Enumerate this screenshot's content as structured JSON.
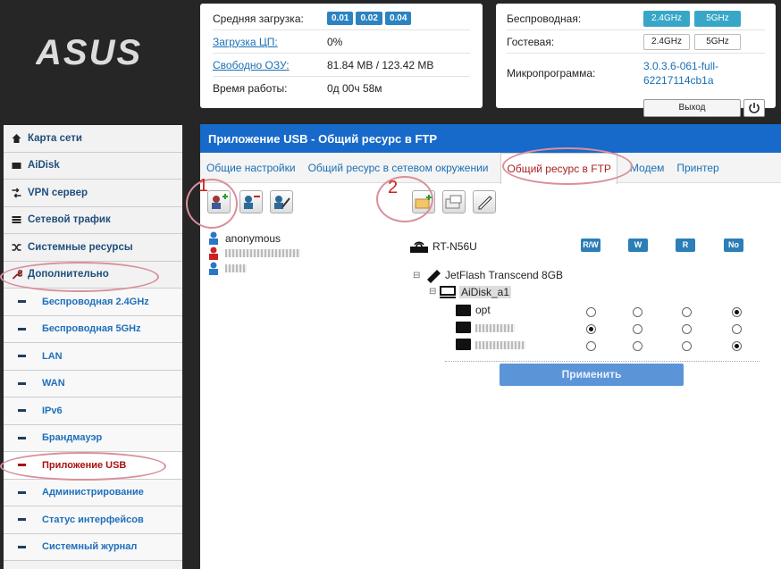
{
  "logo": "ASUS",
  "stats": {
    "load_label": "Средняя загрузка:",
    "load_values": [
      "0.01",
      "0.02",
      "0.04"
    ],
    "cpu_label": "Загрузка ЦП:",
    "cpu_value": "0%",
    "ram_label": "Свободно ОЗУ:",
    "ram_value": "81.84 MB / 123.42 MB",
    "uptime_label": "Время работы:",
    "uptime_value": "0д 00ч 58м"
  },
  "status": {
    "wireless_label": "Беспроводная:",
    "guest_label": "Гостевая:",
    "band_24": "2.4GHz",
    "band_5": "5GHz",
    "fw_label": "Микропрограмма:",
    "fw_value_1": "3.0.3.6-061-full-",
    "fw_value_2": "62217114cb1a",
    "logout": "Выход"
  },
  "sidebar": {
    "items": [
      {
        "label": "Карта сети",
        "icon": "home-icon"
      },
      {
        "label": "AiDisk",
        "icon": "disk-icon"
      },
      {
        "label": "VPN сервер",
        "icon": "vpn-icon"
      },
      {
        "label": "Сетевой трафик",
        "icon": "traffic-icon"
      },
      {
        "label": "Системные ресурсы",
        "icon": "shuffle-icon"
      },
      {
        "label": "Дополнительно",
        "icon": "wrench-icon"
      }
    ],
    "subitems": [
      "Беспроводная 2.4GHz",
      "Беспроводная 5GHz",
      "LAN",
      "WAN",
      "IPv6",
      "Брандмауэр",
      "Приложение USB",
      "Администрирование",
      "Статус интерфейсов",
      "Системный журнал"
    ]
  },
  "main": {
    "title": "Приложение USB - Общий ресурс в FTP",
    "tabs": [
      "Общие настройки",
      "Общий ресурс в сетевом окружении",
      "Общий ресурс в FTP",
      "Модем",
      "Принтер"
    ],
    "annotation_1": "1",
    "annotation_2": "2",
    "user_anonymous": "anonymous",
    "router": "RT-N56U",
    "perm_headers": [
      "R/W",
      "W",
      "R",
      "No"
    ],
    "device": "JetFlash Transcend 8GB",
    "partition": "AiDisk_a1",
    "folder_opt": "opt",
    "apply": "Применить"
  },
  "colors": {
    "accent": "#1769ca",
    "badge": "#2c83c1",
    "toggle_on": "#38a7c7",
    "annotation": "#d9909c"
  }
}
